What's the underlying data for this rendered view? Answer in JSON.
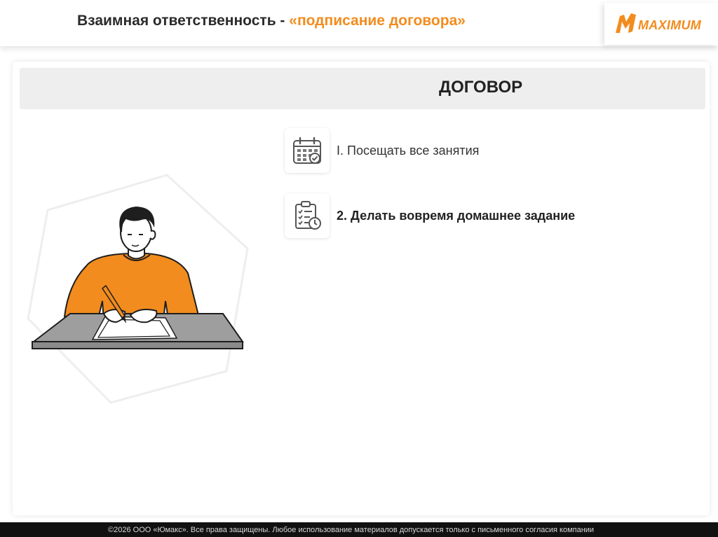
{
  "header": {
    "title_plain": "Взаимная ответственность - ",
    "title_accent": "«подписание договора»"
  },
  "logo": {
    "text": "MAXIMUM",
    "mark_icon": "maximum-logo-mark"
  },
  "banner": {
    "title": "ДОГОВОР"
  },
  "items": [
    {
      "number": "I.",
      "text": "Посещать все занятия",
      "icon": "calendar-check-icon"
    },
    {
      "number": "2.",
      "text": "Делать вовремя домашнее задание",
      "icon": "checklist-clock-icon"
    }
  ],
  "illustration": {
    "subject": "person-signing-document-illustration"
  },
  "footer": {
    "text": "©2026 ООО «Юмакс». Все права защищены. Любое использование материалов допускается только с письменного согласия компании"
  },
  "colors": {
    "accent": "#f28c1e",
    "sweater": "#f28c1e",
    "table": "#9e9e9e",
    "footer_bg": "#111111",
    "banner_bg": "#eeeeee"
  }
}
